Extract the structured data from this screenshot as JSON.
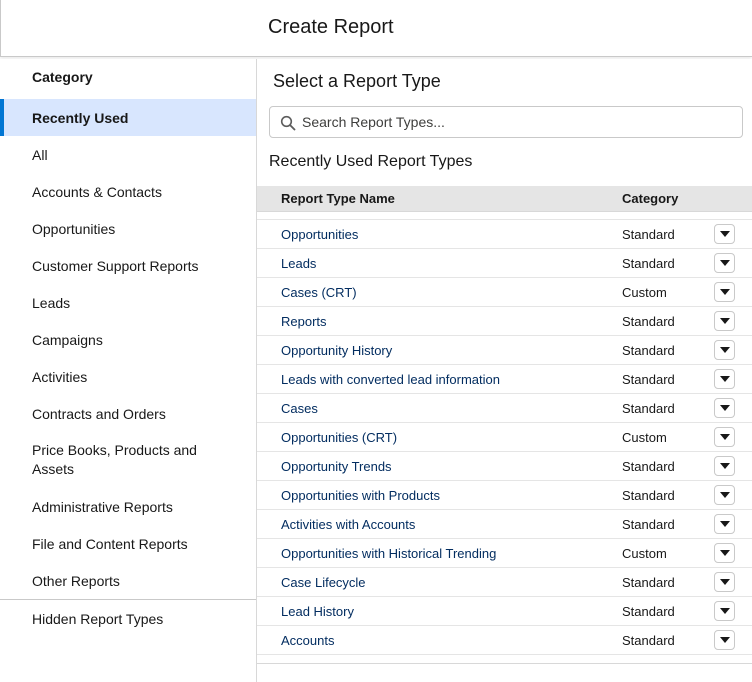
{
  "header": {
    "title": "Create Report"
  },
  "sidebar": {
    "heading": "Category",
    "items": [
      {
        "label": "Recently Used",
        "active": true
      },
      {
        "label": "All"
      },
      {
        "label": "Accounts & Contacts"
      },
      {
        "label": "Opportunities"
      },
      {
        "label": "Customer Support Reports"
      },
      {
        "label": "Leads"
      },
      {
        "label": "Campaigns"
      },
      {
        "label": "Activities"
      },
      {
        "label": "Contracts and Orders"
      },
      {
        "label": "Price Books, Products and Assets"
      },
      {
        "label": "Administrative Reports"
      },
      {
        "label": "File and Content Reports"
      },
      {
        "label": "Other Reports"
      }
    ],
    "hidden_item": "Hidden Report Types"
  },
  "main": {
    "title": "Select a Report Type",
    "search": {
      "placeholder": "Search Report Types...",
      "value": ""
    },
    "section_title": "Recently Used Report Types",
    "columns": [
      "Report Type Name",
      "Category"
    ],
    "rows": [
      {
        "name": "Opportunities",
        "category": "Standard"
      },
      {
        "name": "Leads",
        "category": "Standard"
      },
      {
        "name": "Cases (CRT)",
        "category": "Custom"
      },
      {
        "name": "Reports",
        "category": "Standard"
      },
      {
        "name": "Opportunity History",
        "category": "Standard"
      },
      {
        "name": "Leads with converted lead information",
        "category": "Standard"
      },
      {
        "name": "Cases",
        "category": "Standard"
      },
      {
        "name": "Opportunities (CRT)",
        "category": "Custom"
      },
      {
        "name": "Opportunity Trends",
        "category": "Standard"
      },
      {
        "name": "Opportunities with Products",
        "category": "Standard"
      },
      {
        "name": "Activities with Accounts",
        "category": "Standard"
      },
      {
        "name": "Opportunities with Historical Trending",
        "category": "Custom"
      },
      {
        "name": "Case Lifecycle",
        "category": "Standard"
      },
      {
        "name": "Lead History",
        "category": "Standard"
      },
      {
        "name": "Accounts",
        "category": "Standard"
      }
    ],
    "row_menu_icon": "chevron-down-icon"
  },
  "colors": {
    "active_bg": "#d8e6fe",
    "active_accent": "#0176d3",
    "link": "#032d60",
    "header_row_bg": "#e5e5e5"
  }
}
